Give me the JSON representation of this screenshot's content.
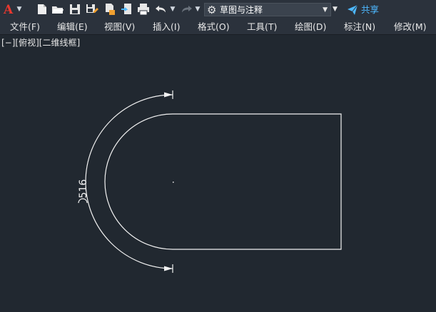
{
  "app": {
    "logo_letter": "A"
  },
  "toolbar": {
    "icons": [
      "app-logo-icon",
      "new-icon",
      "open-icon",
      "save-icon",
      "save-as-icon",
      "publish-icon",
      "import-icon",
      "print-icon",
      "undo-icon",
      "redo-icon"
    ],
    "workspace_label": "草图与注释",
    "share_label": "共享"
  },
  "menu": {
    "items": [
      "文件(F)",
      "编辑(E)",
      "视图(V)",
      "插入(I)",
      "格式(O)",
      "工具(T)",
      "绘图(D)",
      "标注(N)",
      "修改(M)"
    ]
  },
  "viewport": {
    "label": "[−][俯视][二维线框]"
  },
  "drawing": {
    "dimension_text": "516",
    "line_color": "#f2f2f2",
    "background": "#212830"
  }
}
